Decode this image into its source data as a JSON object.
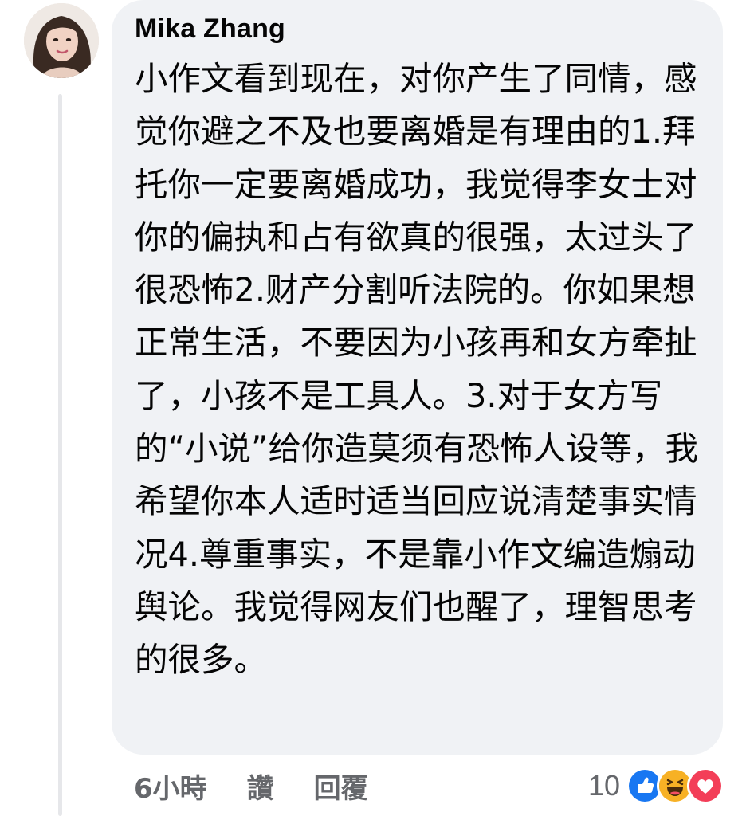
{
  "comment": {
    "author": "Mika Zhang",
    "text": "小作文看到现在，对你产生了同情，感觉你避之不及也要离婚是有理由的1.拜托你一定要离婚成功，我觉得李女士对你的偏执和占有欲真的很强，太过头了很恐怖2.财产分割听法院的。你如果想正常生活，不要因为小孩再和女方牵扯了，小孩不是工具人。3.对于女方写的“小说”给你造莫须有恐怖人设等，我希望你本人适时适当回应说清楚事实情况4.尊重事实，不是靠小作文编造煽动舆论。我觉得网友们也醒了，理智思考的很多。"
  },
  "actions": {
    "time": "6小時",
    "like": "讚",
    "reply": "回覆"
  },
  "reactions": {
    "count": "10",
    "icons": [
      "like-icon",
      "haha-icon",
      "love-icon"
    ],
    "colors": {
      "like": "#1877f2",
      "haha": "#f7b125",
      "love": "#f33e58"
    }
  },
  "colors": {
    "bubble": "#f0f2f5",
    "text": "#050505",
    "secondary": "#65676b"
  }
}
